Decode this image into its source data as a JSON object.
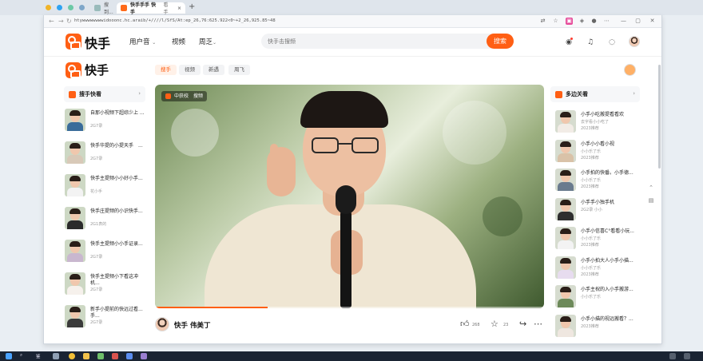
{
  "browser": {
    "tabs": [
      {
        "label": "搜到..."
      },
      {
        "label": "快手手手 快手",
        "sub": "看手",
        "close": "×"
      }
    ],
    "new_tab": "+",
    "url": "htywwwwwwwwidooonc.hc.araib/+////l/SfS/At:ep_26,76:625.922<0~+2_26,925.85~48"
  },
  "site": {
    "brand": "快手",
    "nav": [
      "用户音",
      "视频",
      "周乏"
    ],
    "search": {
      "placeholder": "快手击搜频",
      "button": "搜索"
    }
  },
  "chips": [
    "搜手",
    "视频",
    "新遇",
    "周飞"
  ],
  "left_panel": {
    "title": "搜手快看",
    "arrow": "›",
    "items": [
      {
        "title": "自那小视频下超综少上 ...",
        "sub": "2G7录",
        "body": "#3a6c9a"
      },
      {
        "title": "快手华提的小提天手　...",
        "sub": "2G7录",
        "body": "#d8c9b8"
      },
      {
        "title": "快手主提频小小好小手...",
        "sub": "花小手",
        "body": "#f3f3f3"
      },
      {
        "title": "快手庄提频的小识快手...",
        "sub": "2G1表的",
        "body": "#2b2b2b"
      },
      {
        "title": "快手主提频小小手证录...",
        "sub": "2G7录",
        "body": "#c9b7cf"
      },
      {
        "title": "快手主提频小下看这冲机...",
        "sub": "2G7录",
        "body": "#f6f1ec"
      },
      {
        "title": "新手小提前的快远过看...手...",
        "sub": "2G7录",
        "body": "#3b3b3b"
      }
    ]
  },
  "right_panel": {
    "title": "多边关看",
    "arrow": "›",
    "items": [
      {
        "title": "小手小吃搬提看看欢",
        "sub1": "去字看小小吃了",
        "sub2": "2023推荐",
        "body": "#f2ece6"
      },
      {
        "title": "小手小小看小视",
        "sub1": "小小乐了乐",
        "sub2": "2023推荐",
        "body": "#d9c2a8"
      },
      {
        "title": "小手拍的快番。小手德...",
        "sub1": "小小乐了乐",
        "sub2": "2023推荐",
        "body": "#6a7b8e"
      },
      {
        "title": "小手手小独手机",
        "sub1": "2G2录 小小",
        "body": "#2e2e2e"
      },
      {
        "title": "小手小信喜C°看看小玩...",
        "sub1": "小小乐了乐",
        "sub2": "2023推荐",
        "body": "#f3f3f3"
      },
      {
        "title": "小手小拍大人小手小描...",
        "sub1": "小小乐了乐",
        "sub2": "2023推荐",
        "body": "#e7dcef"
      },
      {
        "title": "小手主祝的入小手搬游...",
        "sub1": "小小乐了乐",
        "body": "#6d8a5a"
      },
      {
        "title": "小手小描的视远搬看？...",
        "sub1": "2023推荐",
        "body": "#efe7e0"
      }
    ]
  },
  "video": {
    "badge": "中获校　搜频",
    "progress": 0.29
  },
  "author": {
    "name": "快手 伟美丁"
  },
  "actions": {
    "likes": "268",
    "stars": "23"
  },
  "taskbar": {
    "search_label": "鉴"
  }
}
